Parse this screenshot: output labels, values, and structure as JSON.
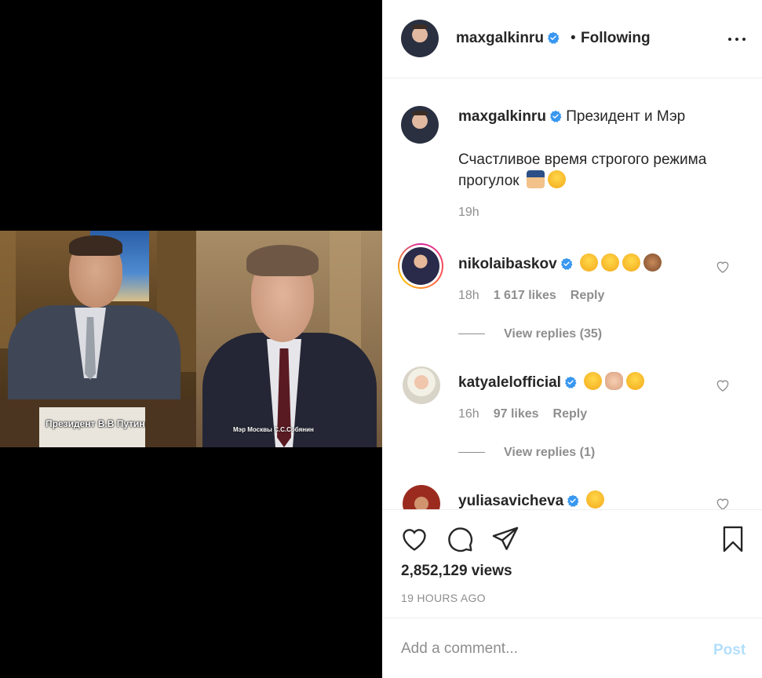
{
  "video": {
    "caption_left": "Президент В.В Путин",
    "caption_right": "Мэр Москвы С.С.Собянин"
  },
  "header": {
    "username": "maxgalkinru",
    "separator": "•",
    "follow_status": "Following",
    "more_icon": "more-horizontal-icon"
  },
  "post": {
    "username": "maxgalkinru",
    "title": "Президент и Мэр",
    "body": "Счастливое время строгого режима прогулок",
    "body_emojis": [
      "police-officer-emoji",
      "rolling-eyes-emoji"
    ],
    "time": "19h"
  },
  "comments": [
    {
      "username": "nikolaibaskov",
      "verified": true,
      "emojis": [
        "tears-of-joy-emoji",
        "tears-of-joy-emoji",
        "tears-of-joy-emoji",
        "see-no-evil-monkey-emoji"
      ],
      "time": "18h",
      "likes": "1 617 likes",
      "reply": "Reply",
      "view_replies": "View replies (35)",
      "has_story_ring": true
    },
    {
      "username": "katyalelofficial",
      "verified": true,
      "emojis": [
        "zany-face-emoji",
        "clapping-hands-emoji",
        "tears-of-joy-emoji"
      ],
      "time": "16h",
      "likes": "97 likes",
      "reply": "Reply",
      "view_replies": "View replies (1)",
      "has_story_ring": false
    },
    {
      "username": "yuliasavicheva",
      "verified": true,
      "emojis": [
        "squinting-laugh-emoji"
      ],
      "has_story_ring": false
    }
  ],
  "actions": {
    "views": "2,852,129 views",
    "time_ago": "19 HOURS AGO"
  },
  "add_comment": {
    "placeholder": "Add a comment...",
    "post_label": "Post"
  },
  "colors": {
    "verified_blue": "#3897f0",
    "muted_text": "#8e8e8e",
    "post_disabled": "#b2dffc",
    "text": "#262626"
  }
}
